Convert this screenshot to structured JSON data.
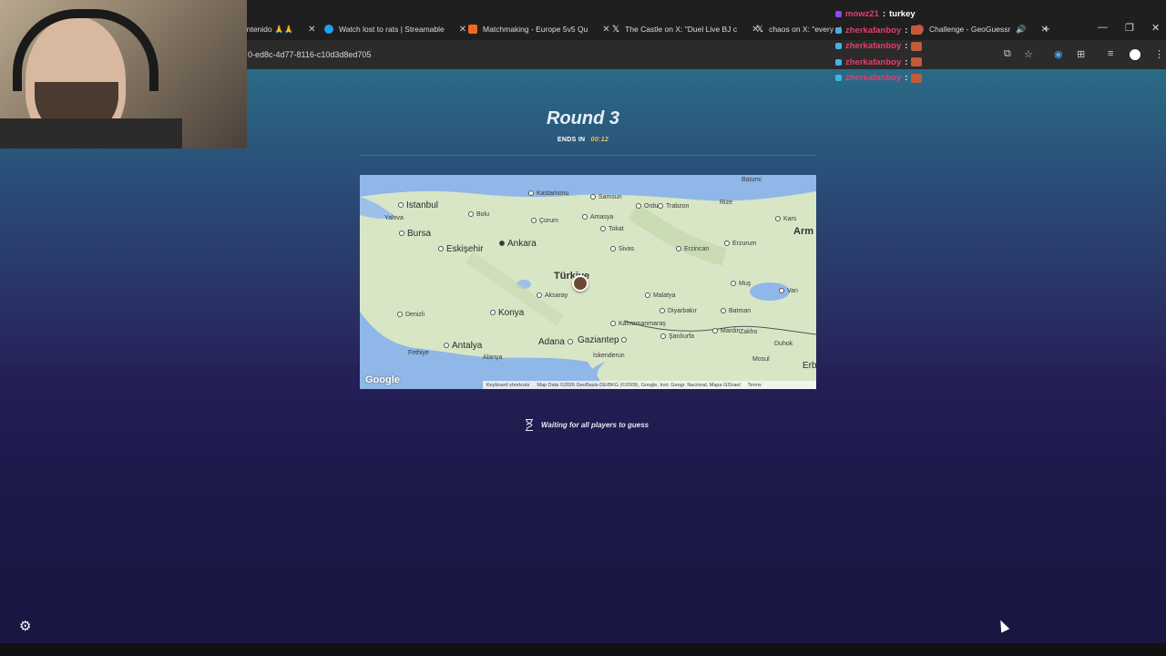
{
  "browser": {
    "tabs": [
      {
        "label": "ontenido 🙏🙏",
        "favicon_color": "#a0a0a0"
      },
      {
        "label": "Watch lost to rats | Streamable",
        "favicon_color": "#1ea0f2"
      },
      {
        "label": "Matchmaking - Europe 5v5 Qu",
        "favicon_color": "#f06a1a"
      },
      {
        "label": "The Castle on X: \"Duel Live BJ c",
        "favicon_color": "#ffffff"
      },
      {
        "label": "chaos on X: \"every si",
        "favicon_color": "#ffffff"
      },
      {
        "label": "Challenge - GeoGuessr",
        "favicon_color": "#d94a5a"
      }
    ],
    "url": "0-ed8c-4d77-8116-c10d3d8ed705",
    "close_glyph": "✕",
    "new_tab_glyph": "+"
  },
  "stream_overlay": {
    "chat": [
      {
        "user": "mowz21",
        "message": "turkey",
        "emote": false
      },
      {
        "user": "zherkafanboy",
        "message": "",
        "emote": true
      },
      {
        "user": "zherkafanboy",
        "message": "",
        "emote": true
      },
      {
        "user": "zherkafanboy",
        "message": "",
        "emote": true
      },
      {
        "user": "zherkafanboy",
        "message": "",
        "emote": true
      }
    ]
  },
  "game": {
    "round_title": "Round 3",
    "ends_in_label": "ENDS IN",
    "ends_in_time": "00:12",
    "waiting_text": "Waiting for all players to guess",
    "map": {
      "provider_logo": "Google",
      "country_label": "Türkiye",
      "cities": [
        {
          "name": "Batumi"
        },
        {
          "name": "Kastamonu"
        },
        {
          "name": "Samsun"
        },
        {
          "name": "Ordu"
        },
        {
          "name": "Trabzon"
        },
        {
          "name": "Rize"
        },
        {
          "name": "Istanbul"
        },
        {
          "name": "Bolu"
        },
        {
          "name": "Çorum"
        },
        {
          "name": "Amasya"
        },
        {
          "name": "Tokat"
        },
        {
          "name": "Kars"
        },
        {
          "name": "Yalova"
        },
        {
          "name": "Bursa"
        },
        {
          "name": "Eskişehir"
        },
        {
          "name": "Ankara"
        },
        {
          "name": "Sivas"
        },
        {
          "name": "Erzincan"
        },
        {
          "name": "Erzurum"
        },
        {
          "name": "Arm"
        },
        {
          "name": "Aksaray"
        },
        {
          "name": "Malatya"
        },
        {
          "name": "Muş"
        },
        {
          "name": "Van"
        },
        {
          "name": "Denizli"
        },
        {
          "name": "Konya"
        },
        {
          "name": "Diyarbakır"
        },
        {
          "name": "Batman"
        },
        {
          "name": "Kahramanmaraş"
        },
        {
          "name": "Adana"
        },
        {
          "name": "Gaziantep"
        },
        {
          "name": "Şanlıurfa"
        },
        {
          "name": "Mardin"
        },
        {
          "name": "Zakho"
        },
        {
          "name": "Antalya"
        },
        {
          "name": "Fethiye"
        },
        {
          "name": "Alanya"
        },
        {
          "name": "İskenderun"
        },
        {
          "name": "Duhok"
        },
        {
          "name": "Mosul"
        },
        {
          "name": "Erb"
        }
      ],
      "attribution": {
        "shortcuts": "Keyboard shortcuts",
        "data": "Map Data ©2026 GeoBasis-DE/BKG (©2009), Google, Inst. Geogr. Nacional, Mapa GISrael",
        "terms": "Terms"
      }
    }
  },
  "colors": {
    "accent_time": "#f3c64a",
    "chat_user": "#e1406a"
  }
}
